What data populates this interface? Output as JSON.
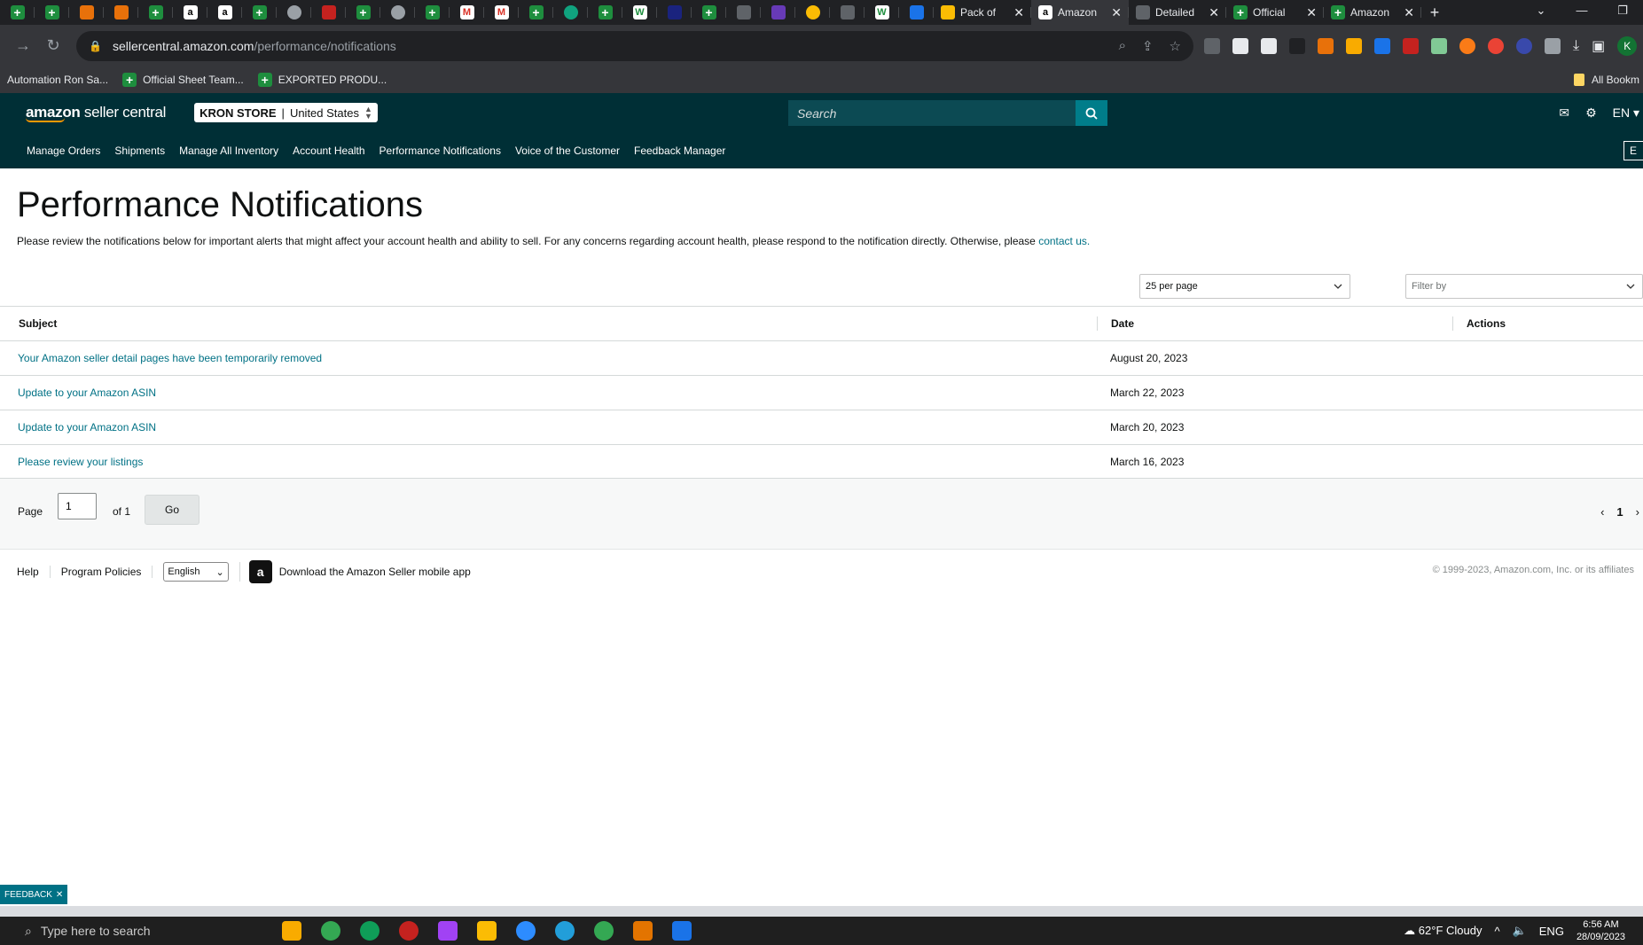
{
  "browser": {
    "tabs": [
      {
        "title": "Pack of",
        "icon": "google-drive-icon"
      },
      {
        "title": "Amazon",
        "icon": "amazon-icon"
      },
      {
        "title": "Detailed",
        "icon": "chart-icon"
      },
      {
        "title": "Official",
        "icon": "sheets-icon"
      },
      {
        "title": "Amazon",
        "icon": "sheets-icon"
      }
    ],
    "url_host": "sellercentral.amazon.com",
    "url_path": "/performance/notifications",
    "bookmarks": [
      "Automation Ron Sa...",
      "Official Sheet Team...",
      "EXPORTED PRODU..."
    ],
    "all_bookmarks": "All Bookm",
    "profile_initial": "K"
  },
  "header": {
    "logo_bold": "amazon",
    "logo_rest": " seller central",
    "store_name": "KRON STORE",
    "store_region": "United States",
    "search_placeholder": "Search",
    "language": "EN"
  },
  "nav": {
    "items": [
      "Manage Orders",
      "Shipments",
      "Manage All Inventory",
      "Account Health",
      "Performance Notifications",
      "Voice of the Customer",
      "Feedback Manager"
    ],
    "edge_label": "E"
  },
  "page": {
    "title": "Performance Notifications",
    "intro": "Please review the notifications below for important alerts that might affect your account health and ability to sell. For any concerns regarding account health, please respond to the notification directly. Otherwise, please ",
    "contact_link": "contact us.",
    "per_page": "25 per page",
    "filter_placeholder": "Filter by"
  },
  "table": {
    "headers": {
      "subject": "Subject",
      "date": "Date",
      "actions": "Actions"
    },
    "rows": [
      {
        "subject": "Your Amazon seller detail pages have been temporarily removed",
        "date": "August 20, 2023"
      },
      {
        "subject": "Update to your Amazon ASIN",
        "date": "March 22, 2023"
      },
      {
        "subject": "Update to your Amazon ASIN",
        "date": "March 20, 2023"
      },
      {
        "subject": "Please review your listings",
        "date": "March 16, 2023"
      }
    ]
  },
  "pager": {
    "page_label": "Page",
    "current": "1",
    "of_label": "of 1",
    "go_label": "Go",
    "page_number": "1"
  },
  "footer": {
    "help": "Help",
    "policies": "Program Policies",
    "language": "English",
    "app_text": "Download the Amazon Seller mobile app",
    "copyright": "© 1999-2023, Amazon.com, Inc. or its affiliates"
  },
  "feedback_label": "FEEDBACK",
  "taskbar": {
    "search_placeholder": "Type here to search",
    "weather": "62°F  Cloudy",
    "input_lang": "ENG",
    "time": "6:56 AM",
    "date": "28/09/2023"
  }
}
